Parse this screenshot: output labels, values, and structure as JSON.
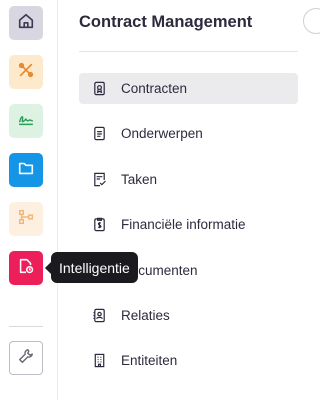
{
  "sidebar": {
    "rail": [
      {
        "icon": "home-icon",
        "bg": "#d8d6e0",
        "fg": "#3c3a55"
      },
      {
        "icon": "tools-icon",
        "bg": "#fde9cc",
        "fg": "#e8872b"
      },
      {
        "icon": "signature-icon",
        "bg": "#def2e4",
        "fg": "#2e9e55"
      },
      {
        "icon": "folder-icon",
        "bg": "#1495e6",
        "fg": "#ffffff"
      },
      {
        "icon": "workflow-icon",
        "bg": "#fdf0e0",
        "fg": "#f0b77a"
      },
      {
        "icon": "document-clock-icon",
        "bg": "#ec1f5a",
        "fg": "#ffffff"
      }
    ],
    "settings_icon": "wrench-icon",
    "tooltip": "Intelligentie"
  },
  "panel": {
    "title": "Contract Management",
    "items": [
      {
        "label": "Contracten",
        "icon": "contract-icon",
        "active": true
      },
      {
        "label": "Onderwerpen",
        "icon": "document-lines-icon",
        "active": false
      },
      {
        "label": "Taken",
        "icon": "task-check-icon",
        "active": false
      },
      {
        "label": "Financiële informatie",
        "icon": "finance-document-icon",
        "active": false
      },
      {
        "label": "Documenten",
        "icon": "documents-icon",
        "active": false
      },
      {
        "label": "Relaties",
        "icon": "address-book-icon",
        "active": false
      },
      {
        "label": "Entiteiten",
        "icon": "building-icon",
        "active": false
      }
    ]
  }
}
